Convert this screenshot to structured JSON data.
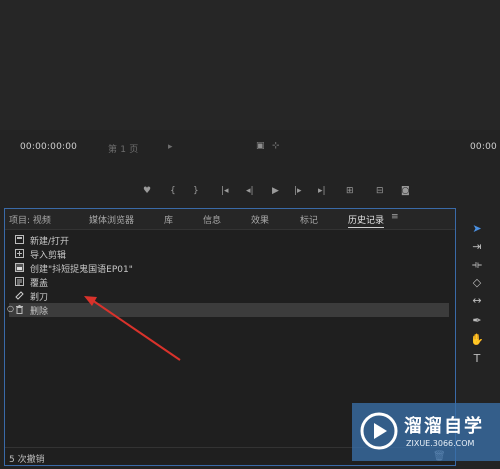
{
  "monitor": {
    "timecode_left": "00:00:00:00",
    "page_select": "第 1 页",
    "timecode_right": "00:00"
  },
  "tabs": [
    {
      "label": "项目: 视频"
    },
    {
      "label": "媒体浏览器"
    },
    {
      "label": "库"
    },
    {
      "label": "信息"
    },
    {
      "label": "效果"
    },
    {
      "label": "标记"
    },
    {
      "label": "历史记录",
      "active": true
    }
  ],
  "history": [
    {
      "label": "新建/打开",
      "icon": "new-open-icon"
    },
    {
      "label": "导入剪辑",
      "icon": "import-clip-icon"
    },
    {
      "label": "创建\"抖短捉鬼国语EP01\"",
      "icon": "create-sequence-icon"
    },
    {
      "label": "覆盖",
      "icon": "overwrite-icon"
    },
    {
      "label": "剃刀",
      "icon": "razor-icon"
    },
    {
      "label": "删除",
      "icon": "delete-icon",
      "selected": true
    }
  ],
  "footer": {
    "undo_count": "5 次撤销"
  },
  "watermark": {
    "brand": "溜溜自学",
    "url": "ZIXUE.3066.COM"
  },
  "colors": {
    "panel_border": "#3a6aa8",
    "arrow": "#d9322b",
    "watermark_bg": "#3a70a8"
  }
}
